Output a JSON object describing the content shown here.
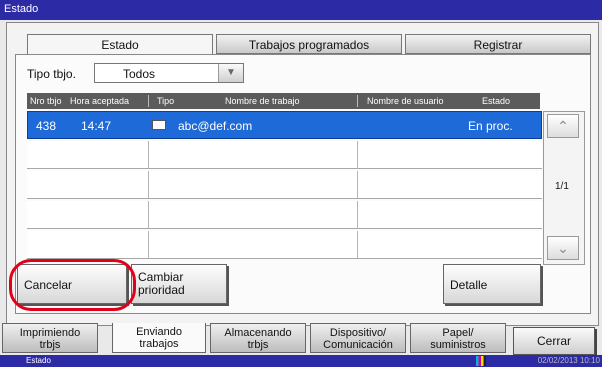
{
  "window": {
    "title": "Estado"
  },
  "tabs": [
    {
      "label": "Estado",
      "active": true
    },
    {
      "label": "Trabajos programados",
      "active": false
    },
    {
      "label": "Registrar",
      "active": false
    }
  ],
  "filter": {
    "label": "Tipo tbjo.",
    "value": "Todos"
  },
  "table": {
    "columns": [
      "Nro tbjo",
      "Hora aceptada",
      "Tipo",
      "Nombre de trabajo",
      "Nombre de usuario",
      "Estado"
    ],
    "rows": [
      {
        "nro": "438",
        "hora": "14:47",
        "tipo_icon": "mail-icon",
        "nombre": "abc@def.com",
        "usuario": "",
        "estado": "En proc.",
        "selected": true
      }
    ],
    "page": "1/1"
  },
  "buttons": {
    "cancelar": "Cancelar",
    "cambiar_line1": "Cambiar",
    "cambiar_line2": "prioridad",
    "detalle": "Detalle"
  },
  "bottom_tabs": [
    {
      "line1": "Imprimiendo",
      "line2": "trbjs"
    },
    {
      "line1": "Enviando",
      "line2": "trabajos",
      "active": true
    },
    {
      "line1": "Almacenando",
      "line2": "trbjs"
    },
    {
      "line1": "Dispositivo/",
      "line2": "Comunicación"
    },
    {
      "line1": "Papel/",
      "line2": "suministros"
    }
  ],
  "close_button": "Cerrar",
  "status_bar": {
    "left": "Estado",
    "datetime": "02/02/2013 10:10"
  },
  "colors": {
    "title_bar": "#2d2aa6",
    "selected_row": "#1e6ad8",
    "highlight_ring": "#e0001a"
  }
}
